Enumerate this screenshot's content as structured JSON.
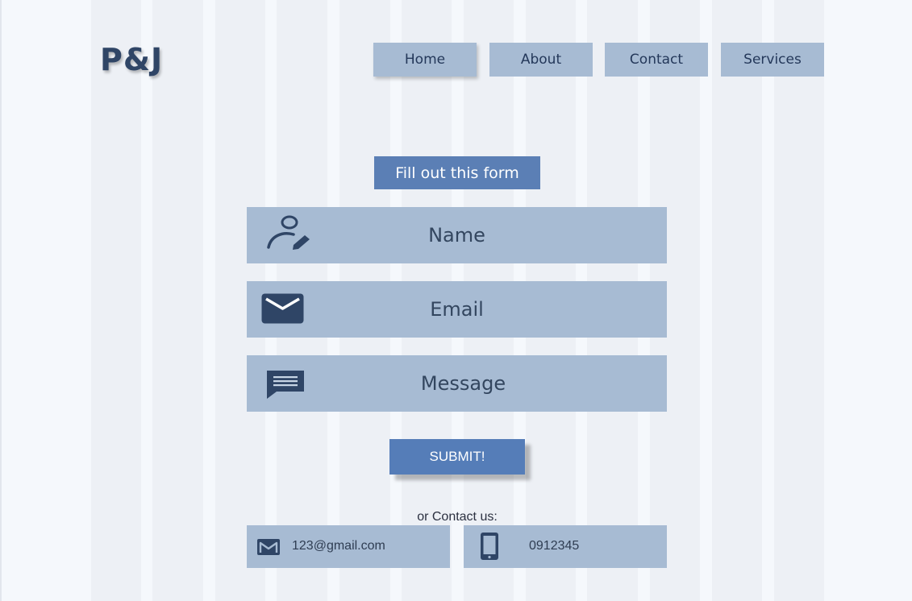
{
  "brand": {
    "logo": "P&J"
  },
  "nav": {
    "items": [
      "Home",
      "About",
      "Contact",
      "Services"
    ]
  },
  "form": {
    "title": "Fill out this form",
    "fields": {
      "name": "Name",
      "email": "Email",
      "message": "Message"
    },
    "submit_label": "SUBMIT!"
  },
  "contact": {
    "intro": "or Contact us:",
    "email": "123@gmail.com",
    "phone": "0912345"
  },
  "colors": {
    "background": "#f5f8fc",
    "panel": "#a7bbd3",
    "accent": "#557db8",
    "text_dark": "#2b3a55"
  },
  "icons": {
    "name_field": "user-edit-icon",
    "email_field": "envelope-icon",
    "message_field": "chat-bubble-icon",
    "contact_email": "mail-icon",
    "contact_phone": "phone-icon"
  }
}
